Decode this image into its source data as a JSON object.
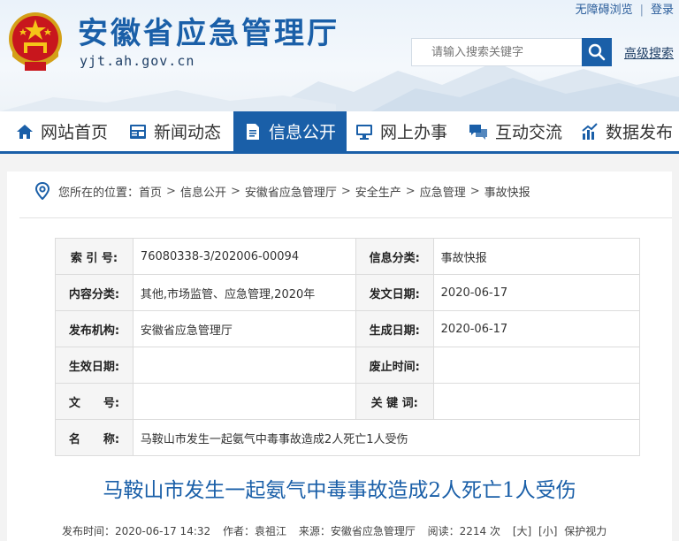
{
  "header": {
    "site_title": "安徽省应急管理厅",
    "site_domain": "yjt.ah.gov.cn",
    "top_links": [
      "无障碍浏览",
      "登录"
    ],
    "search_placeholder": "请输入搜索关键字",
    "advanced_search": "高级搜索"
  },
  "nav": {
    "items": [
      {
        "label": "网站首页",
        "icon": "home-icon"
      },
      {
        "label": "新闻动态",
        "icon": "news-icon"
      },
      {
        "label": "信息公开",
        "icon": "document-icon",
        "active": true
      },
      {
        "label": "网上办事",
        "icon": "monitor-icon"
      },
      {
        "label": "互动交流",
        "icon": "chat-icon"
      },
      {
        "label": "数据发布",
        "icon": "chart-icon"
      }
    ]
  },
  "breadcrumb": {
    "prefix": "您所在的位置：",
    "items": [
      "首页",
      "信息公开",
      "安徽省应急管理厅",
      "安全生产",
      "应急管理",
      "事故快报"
    ],
    "separator": ">"
  },
  "meta_table": {
    "rows": [
      {
        "k1": "索 引 号:",
        "v1": "76080338-3/202006-00094",
        "k2": "信息分类:",
        "v2": "事故快报"
      },
      {
        "k1": "内容分类:",
        "v1": "其他,市场监管、应急管理,2020年",
        "k2": "发文日期:",
        "v2": "2020-06-17"
      },
      {
        "k1": "发布机构:",
        "v1": "安徽省应急管理厅",
        "k2": "生成日期:",
        "v2": "2020-06-17"
      },
      {
        "k1": "生效日期:",
        "v1": "",
        "k2": "废止时间:",
        "v2": ""
      },
      {
        "k1": "文　　号:",
        "v1": "",
        "k2": "关 键 词:",
        "v2": ""
      }
    ],
    "name_label": "名　　称:",
    "name_value": "马鞍山市发生一起氨气中毒事故造成2人死亡1人受伤"
  },
  "article": {
    "title": "马鞍山市发生一起氨气中毒事故造成2人死亡1人受伤",
    "publish_time": "发布时间：2020-06-17 14:32",
    "author": "作者：袁祖江",
    "source": "来源：安徽省应急管理厅",
    "reads": "阅读：2214 次",
    "font_large": "[大]",
    "font_small": "[小]",
    "eye_care": "保护视力"
  },
  "colors": {
    "brand_blue": "#1a5fa8",
    "title_blue": "#1a5fa8"
  }
}
